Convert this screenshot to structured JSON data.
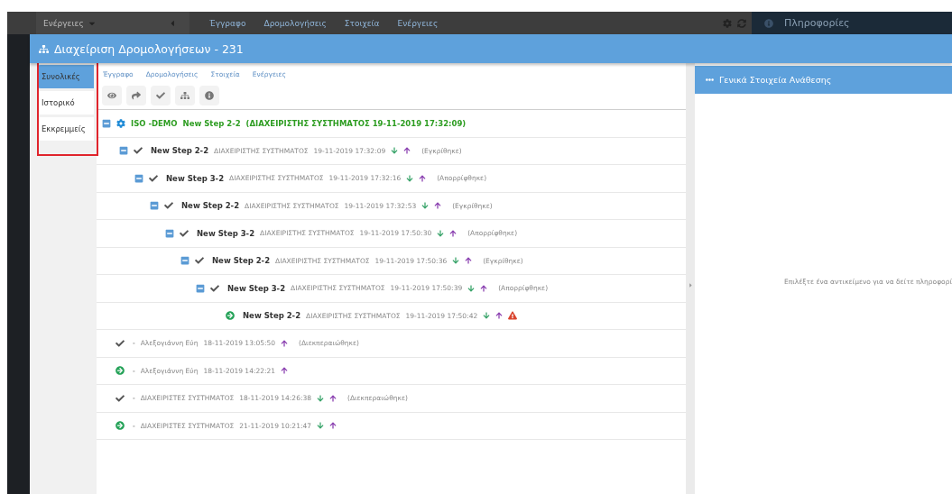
{
  "background": {
    "actions_menu": "Ενέργειες",
    "nav_links": [
      "Έγγραφο",
      "Δρομολογήσεις",
      "Στοιχεία",
      "Ενέργειες"
    ],
    "info_tab": "Πληροφορίες"
  },
  "dialog": {
    "title": "Διαχείριση Δρομολογήσεων - 231",
    "side_tabs": [
      {
        "label": "Συνολικές",
        "selected": true
      },
      {
        "label": "Ιστορικό",
        "selected": false
      },
      {
        "label": "Εκκρεμμείς",
        "selected": false
      }
    ],
    "side_tabs_outlined": true,
    "links": [
      "Έγγραφο",
      "Δρομολογήσεις",
      "Στοιχεία",
      "Ενέργειες"
    ],
    "tree": {
      "expanded": true,
      "project": "ISO -DEMO",
      "step": "New Step 2-2",
      "detail": "(ΔΙΑΧΕΙΡΙΣΤΗΣ ΣΥΣΤΗΜΑΤΟΣ 19-11-2019 17:32:09)",
      "children": [
        {
          "done": true,
          "expanded": true,
          "step": "New Step 2-2",
          "user": "ΔΙΑΧΕΙΡΙΣΤΗΣ ΣΥΣΤΗΜΑΤΟΣ",
          "date": "19-11-2019 17:32:09",
          "down": true,
          "up": true,
          "result": "(Εγκρίθηκε)",
          "warning": false,
          "children": [
            {
              "done": true,
              "expanded": true,
              "step": "New Step 3-2",
              "user": "ΔΙΑΧΕΙΡΙΣΤΗΣ ΣΥΣΤΗΜΑΤΟΣ",
              "date": "19-11-2019 17:32:16",
              "down": true,
              "up": true,
              "result": "(Απορρίφθηκε)",
              "warning": false,
              "children": [
                {
                  "done": true,
                  "expanded": true,
                  "step": "New Step 2-2",
                  "user": "ΔΙΑΧΕΙΡΙΣΤΗΣ ΣΥΣΤΗΜΑΤΟΣ",
                  "date": "19-11-2019 17:32:53",
                  "down": true,
                  "up": true,
                  "result": "(Εγκρίθηκε)",
                  "warning": false,
                  "children": [
                    {
                      "done": true,
                      "expanded": true,
                      "step": "New Step 3-2",
                      "user": "ΔΙΑΧΕΙΡΙΣΤΗΣ ΣΥΣΤΗΜΑΤΟΣ",
                      "date": "19-11-2019 17:50:30",
                      "down": true,
                      "up": true,
                      "result": "(Απορρίφθηκε)",
                      "warning": false,
                      "children": [
                        {
                          "done": true,
                          "expanded": true,
                          "step": "New Step 2-2",
                          "user": "ΔΙΑΧΕΙΡΙΣΤΗΣ ΣΥΣΤΗΜΑΤΟΣ",
                          "date": "19-11-2019 17:50:36",
                          "down": true,
                          "up": true,
                          "result": "(Εγκρίθηκε)",
                          "warning": false,
                          "children": [
                            {
                              "done": true,
                              "expanded": true,
                              "step": "New Step 3-2",
                              "user": "ΔΙΑΧΕΙΡΙΣΤΗΣ ΣΥΣΤΗΜΑΤΟΣ",
                              "date": "19-11-2019 17:50:39",
                              "down": true,
                              "up": true,
                              "result": "(Απορρίφθηκε)",
                              "warning": false,
                              "children": [
                                {
                                  "done": false,
                                  "step": "New Step 2-2",
                                  "user": "ΔΙΑΧΕΙΡΙΣΤΗΣ ΣΥΣΤΗΜΑΤΟΣ",
                                  "date": "19-11-2019 17:50:42",
                                  "down": true,
                                  "up": true,
                                  "warning": true
                                }
                              ]
                            }
                          ]
                        }
                      ]
                    }
                  ]
                }
              ]
            }
          ]
        }
      ]
    },
    "entries": [
      {
        "done": true,
        "separator": "-",
        "user": "Αλεξογιάννη Εύη",
        "date": "18-11-2019 13:05:50",
        "down": false,
        "up": true,
        "result": "(Διεκπεραιώθηκε)"
      },
      {
        "done": false,
        "separator": "-",
        "user": "Αλεξογιάννη Εύη",
        "date": "18-11-2019 14:22:21",
        "down": false,
        "up": true
      },
      {
        "done": true,
        "separator": "-",
        "user": "ΔΙΑΧΕΙΡΙΣΤΕΣ ΣΥΣΤΗΜΑΤΟΣ",
        "date": "18-11-2019 14:26:38",
        "down": true,
        "up": true,
        "result": "(Διεκπεραιώθηκε)"
      },
      {
        "done": false,
        "separator": "-",
        "user": "ΔΙΑΧΕΙΡΙΣΤΕΣ ΣΥΣΤΗΜΑΤΟΣ",
        "date": "21-11-2019 10:21:47",
        "down": true,
        "up": true
      }
    ],
    "panel_title": "Γενικά Στοιχεία Ανάθεσης",
    "empty_message": "Επιλέξτε ένα αντικείμενο για να δείτε πληροφορί"
  }
}
